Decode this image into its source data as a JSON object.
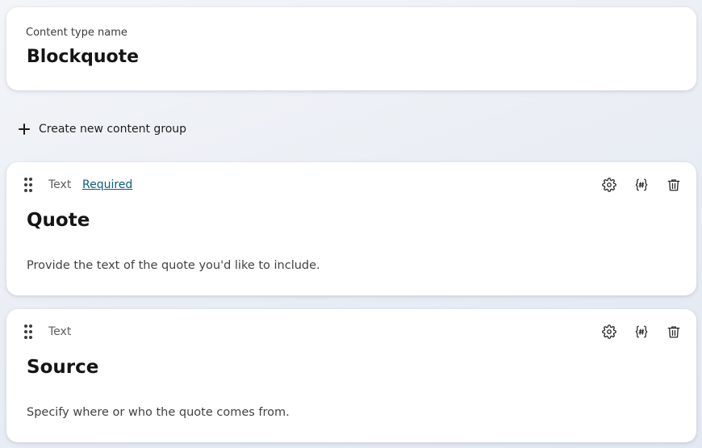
{
  "content_type": {
    "label": "Content type name",
    "name": "Blockquote"
  },
  "create_group": {
    "label": "Create new content group",
    "icon": "plus-icon"
  },
  "fields": [
    {
      "type": "Text",
      "required_label": "Required",
      "title": "Quote",
      "description": "Provide the text of the quote you'd like to include.",
      "actions": [
        "gear-icon",
        "variable-icon",
        "trash-icon"
      ]
    },
    {
      "type": "Text",
      "title": "Source",
      "description": "Specify where or who the quote comes from.",
      "actions": [
        "gear-icon",
        "variable-icon",
        "trash-icon"
      ]
    }
  ],
  "colors": {
    "link": "#0f5d7a",
    "text": "#151515",
    "muted": "#5d5d5d",
    "card": "#ffffff"
  }
}
